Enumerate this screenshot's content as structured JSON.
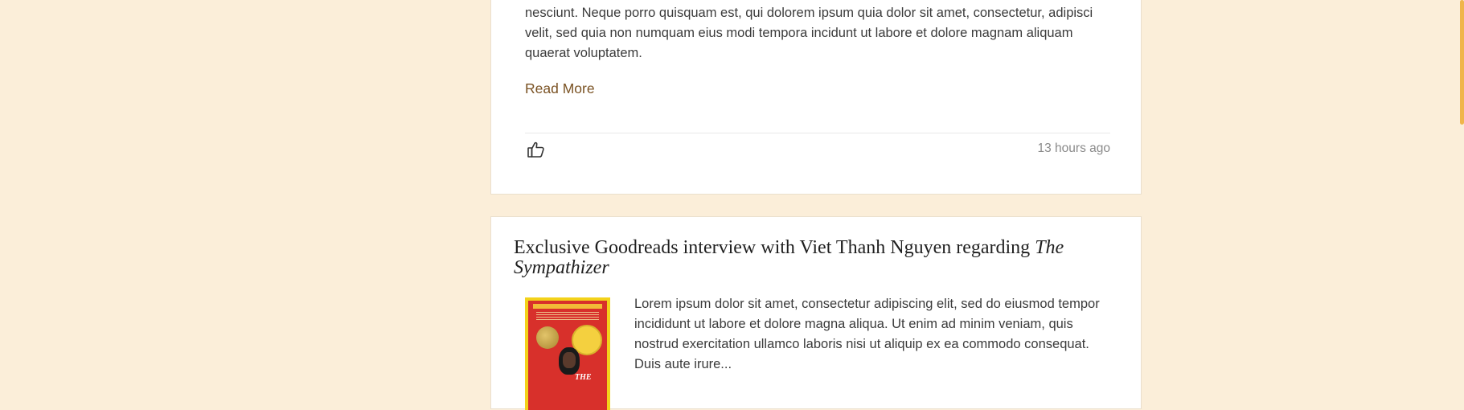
{
  "posts": [
    {
      "body_tail": "nesciunt. Neque porro quisquam est, qui dolorem ipsum quia dolor sit amet, consectetur, adipisci velit, sed quia non numquam eius modi tempora incidunt ut labore et dolore magnam aliquam quaerat voluptatem.",
      "read_more": "Read More",
      "timestamp": "13 hours ago",
      "like_icon": "thumbs-up-icon"
    },
    {
      "title_main": "Exclusive Goodreads interview with Viet Thanh Nguyen regarding",
      "title_book": "The Sympathizer",
      "book_cover_title": "THE",
      "excerpt": "Lorem ipsum dolor sit amet, consectetur adipiscing elit, sed do eiusmod tempor incididunt ut labore et dolore magna aliqua. Ut enim ad minim veniam, quis nostrud exercitation ullamco laboris nisi ut aliquip ex ea commodo consequat. Duis aute irure..."
    }
  ],
  "colors": {
    "page_bg": "#fbeed9",
    "link": "#7a5223",
    "scrollbar": "#f0b54b"
  }
}
